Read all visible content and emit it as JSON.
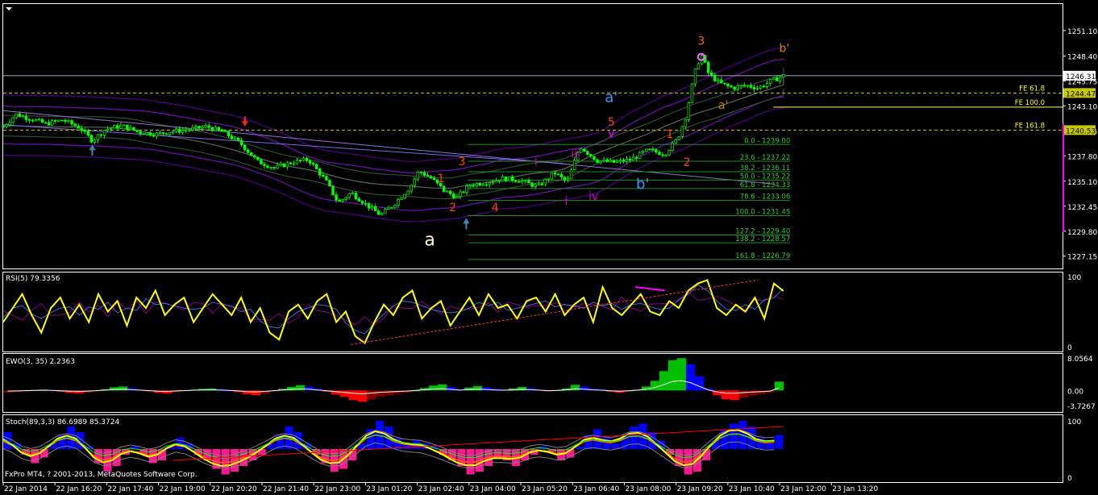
{
  "platform": {
    "copyright": "FxPro MT4, ? 2001-2013, MetaQuotes Software Corp."
  },
  "colors": {
    "background": "#000000",
    "grid_border": "#ffffff",
    "candle": "#00ff00",
    "rsi_line": "#ffff00",
    "ewo_positive_up": "#00c000",
    "ewo_positive_down": "#0000ff",
    "ewo_negative_up": "#800000",
    "ewo_negative_down": "#ff0000",
    "stoch_hist_pos": "#0000ff",
    "stoch_hist_neg": "#ff1493",
    "fib_lines": "#228b22",
    "fe_lines": "#ffff00",
    "envelope": "#800080"
  },
  "chart_data": [
    {
      "type": "candlestick",
      "panel": "price",
      "y_ticks": [
        "1251.10",
        "1248.40",
        "1245.75",
        "1243.10",
        "1240.45",
        "1237.80",
        "1235.10",
        "1232.45",
        "1229.80",
        "1227.15"
      ],
      "y_values": [
        1251.1,
        1248.4,
        1245.75,
        1243.1,
        1240.45,
        1237.8,
        1235.1,
        1232.45,
        1229.8,
        1227.15
      ],
      "ylim": [
        1226.1,
        1252.8
      ],
      "current_price": "1246.31",
      "price_tags": [
        "1244.47",
        "1240.53"
      ],
      "x_ticks": [
        "22 Jan 2014",
        "22 Jan 16:20",
        "22 Jan 17:40",
        "22 Jan 19:00",
        "22 Jan 20:20",
        "22 Jan 21:40",
        "22 Jan 23:00",
        "23 Jan 01:20",
        "23 Jan 02:40",
        "23 Jan 04:00",
        "23 Jan 05:20",
        "23 Jan 06:40",
        "23 Jan 08:00",
        "23 Jan 09:20",
        "23 Jan 10:40",
        "23 Jan 12:00",
        "23 Jan 13:20"
      ],
      "close_path": [
        [
          0,
          1240.9
        ],
        [
          1.5,
          1242.2
        ],
        [
          3,
          1241.8
        ],
        [
          5,
          1241.2
        ],
        [
          7,
          1241.6
        ],
        [
          9,
          1240.8
        ],
        [
          10.5,
          1239.4
        ],
        [
          12,
          1240.6
        ],
        [
          14,
          1241.0
        ],
        [
          16,
          1240.3
        ],
        [
          18,
          1240.1
        ],
        [
          20,
          1240.4
        ],
        [
          22,
          1240.6
        ],
        [
          24,
          1240.9
        ],
        [
          26,
          1240.3
        ],
        [
          28,
          1239.1
        ],
        [
          30,
          1237.2
        ],
        [
          32,
          1236.5
        ],
        [
          34,
          1237.1
        ],
        [
          36,
          1237.4
        ],
        [
          38,
          1235.2
        ],
        [
          39.5,
          1232.8
        ],
        [
          41,
          1233.9
        ],
        [
          43,
          1232.5
        ],
        [
          44.5,
          1231.5
        ],
        [
          46,
          1232.6
        ],
        [
          48,
          1234.5
        ],
        [
          49,
          1236.2
        ],
        [
          50.5,
          1235.4
        ],
        [
          52,
          1234.1
        ],
        [
          53.5,
          1233.4
        ],
        [
          55,
          1234.7
        ],
        [
          57,
          1235.0
        ],
        [
          59,
          1235.4
        ],
        [
          61,
          1235.2
        ],
        [
          63,
          1234.5
        ],
        [
          65,
          1236.0
        ],
        [
          66.5,
          1235.0
        ],
        [
          68,
          1238.8
        ],
        [
          70,
          1237.3
        ],
        [
          72,
          1237.1
        ],
        [
          74,
          1237.4
        ],
        [
          76,
          1238.4
        ],
        [
          78,
          1238.0
        ],
        [
          79.5,
          1239.6
        ],
        [
          80.5,
          1242.0
        ],
        [
          81.5,
          1246.5
        ],
        [
          82.3,
          1248.6
        ],
        [
          83.2,
          1246.5
        ],
        [
          84.5,
          1245.5
        ],
        [
          86,
          1245.0
        ],
        [
          87.5,
          1245.3
        ],
        [
          89,
          1245.0
        ],
        [
          90.5,
          1245.7
        ],
        [
          92,
          1246.31
        ]
      ],
      "wave_labels": [
        {
          "text": "3",
          "x": 82.3,
          "y": 1249.6,
          "color": "#ff6600"
        },
        {
          "text": "b'",
          "x": 92.1,
          "y": 1248.8,
          "color": "#cc8800"
        },
        {
          "text": "a'",
          "x": 71.7,
          "y": 1243.5,
          "color": "#3399ff"
        },
        {
          "text": "a'",
          "x": 84.9,
          "y": 1242.8,
          "color": "#cc8800"
        },
        {
          "text": "5",
          "x": 71.7,
          "y": 1241.0,
          "color": "#ff4400"
        },
        {
          "text": "v",
          "x": 71.7,
          "y": 1239.8,
          "color": "#ff00ff"
        },
        {
          "text": "1",
          "x": 78.6,
          "y": 1239.7,
          "color": "#ff4400"
        },
        {
          "text": "iii",
          "x": 67.5,
          "y": 1237.6,
          "color": "#cc00cc"
        },
        {
          "text": "3",
          "x": 54.1,
          "y": 1236.8,
          "color": "#ff4400"
        },
        {
          "text": "i",
          "x": 62.8,
          "y": 1236.8,
          "color": "#cc00cc"
        },
        {
          "text": "2",
          "x": 80.6,
          "y": 1236.7,
          "color": "#ff4400"
        },
        {
          "text": "1",
          "x": 51.6,
          "y": 1235.0,
          "color": "#ff4400"
        },
        {
          "text": "b'",
          "x": 75.4,
          "y": 1234.3,
          "color": "#3399ff"
        },
        {
          "text": "iv",
          "x": 69.6,
          "y": 1233.1,
          "color": "#cc00cc"
        },
        {
          "text": "i",
          "x": 66.4,
          "y": 1232.6,
          "color": "#cc00cc"
        },
        {
          "text": "2",
          "x": 53.0,
          "y": 1231.9,
          "color": "#ff4400"
        },
        {
          "text": "4",
          "x": 58.0,
          "y": 1231.9,
          "color": "#ff4400"
        },
        {
          "text": "a",
          "x": 50.3,
          "y": 1228.3,
          "color": "#ffffcc"
        }
      ],
      "fib_retracement": [
        {
          "label": "0.0 - 1239.00",
          "value": 1239.0
        },
        {
          "label": "23.6 - 1237.22",
          "value": 1237.22
        },
        {
          "label": "38.2 - 1236.11",
          "value": 1236.11
        },
        {
          "label": "50.0 - 1235.22",
          "value": 1235.22
        },
        {
          "label": "61.8 - 1234.33",
          "value": 1234.33
        },
        {
          "label": "78.6 - 1233.06",
          "value": 1233.06
        },
        {
          "label": "100.0 - 1231.45",
          "value": 1231.45
        },
        {
          "label": "127.2 - 1229.40",
          "value": 1229.4
        },
        {
          "label": "138.2 - 1228.57",
          "value": 1228.57
        },
        {
          "label": "161.8 - 1226.79",
          "value": 1226.79
        }
      ],
      "fib_expansion": [
        {
          "label": "FE 61.8",
          "value": 1244.47
        },
        {
          "label": "FE 100.0",
          "value": 1242.97
        },
        {
          "label": "FE 161.8",
          "value": 1240.53
        }
      ]
    },
    {
      "type": "line",
      "panel": "rsi",
      "title": "RSI(5) 79.3356",
      "y_ticks": [
        "100",
        "0"
      ],
      "ylim": [
        0,
        100
      ],
      "values": [
        35,
        55,
        75,
        45,
        20,
        55,
        70,
        40,
        60,
        35,
        75,
        50,
        65,
        30,
        70,
        55,
        80,
        45,
        60,
        70,
        35,
        55,
        75,
        60,
        45,
        70,
        35,
        55,
        20,
        10,
        50,
        60,
        40,
        65,
        75,
        35,
        50,
        15,
        5,
        35,
        60,
        45,
        70,
        80,
        40,
        55,
        65,
        30,
        50,
        70,
        45,
        75,
        55,
        60,
        40,
        65,
        70,
        50,
        75,
        45,
        60,
        70,
        35,
        85,
        55,
        45,
        60,
        75,
        50,
        45,
        65,
        55,
        80,
        90,
        95,
        55,
        45,
        60,
        50,
        70,
        40,
        90,
        79.3
      ]
    },
    {
      "type": "bar",
      "panel": "ewo",
      "title": "EWO(3, 35) 2.2363",
      "y_ticks": [
        "8.0564",
        "0.00",
        "-3.7267"
      ],
      "ylim": [
        -3.7267,
        8.0564
      ],
      "values": [
        -0.5,
        -0.4,
        -0.2,
        0.1,
        0.2,
        0.1,
        -0.3,
        -0.6,
        -0.8,
        -0.5,
        -0.2,
        0.3,
        0.8,
        1.0,
        0.6,
        0.2,
        -0.2,
        -0.6,
        -0.8,
        -0.4,
        -0.1,
        0.2,
        0.4,
        0.5,
        0.3,
        0.0,
        -0.4,
        -0.9,
        -1.2,
        -0.8,
        -0.2,
        0.4,
        0.9,
        1.3,
        1.0,
        0.4,
        -0.3,
        -1.0,
        -1.6,
        -2.4,
        -2.8,
        -2.2,
        -1.5,
        -1.2,
        -0.8,
        -0.5,
        0.0,
        0.6,
        1.2,
        1.5,
        0.9,
        0.3,
        0.7,
        1.1,
        0.8,
        0.4,
        0.2,
        0.5,
        0.9,
        0.6,
        0.2,
        -0.2,
        0.1,
        0.5,
        1.4,
        1.0,
        0.5,
        0.2,
        -0.3,
        -0.6,
        -0.3,
        0.2,
        1.0,
        2.4,
        4.8,
        7.5,
        8.0,
        6.5,
        3.5,
        0.5,
        -1.2,
        -2.2,
        -2.4,
        -1.8,
        -1.3,
        -0.9,
        -0.5,
        2.2
      ]
    },
    {
      "type": "bar",
      "panel": "stoch",
      "title": "Stoch(89,3,3) 86.6989 85.3724",
      "y_ticks": [
        "100",
        "0"
      ],
      "ylim": [
        0,
        100
      ],
      "values": [
        30,
        10,
        -10,
        -25,
        -15,
        10,
        25,
        40,
        30,
        5,
        -25,
        -40,
        -30,
        -10,
        5,
        -10,
        -25,
        -20,
        5,
        20,
        10,
        -10,
        -20,
        -35,
        -45,
        -40,
        -30,
        -20,
        -10,
        10,
        25,
        40,
        30,
        10,
        -10,
        -25,
        -40,
        -35,
        -20,
        10,
        35,
        50,
        40,
        20,
        10,
        15,
        10,
        5,
        -10,
        -20,
        -30,
        -45,
        -40,
        -30,
        -15,
        -20,
        -30,
        -20,
        -10,
        5,
        -5,
        -20,
        -15,
        5,
        25,
        35,
        20,
        10,
        25,
        40,
        45,
        30,
        15,
        -10,
        -30,
        -45,
        -40,
        -20,
        15,
        35,
        45,
        50,
        40,
        20,
        10,
        25
      ]
    }
  ]
}
